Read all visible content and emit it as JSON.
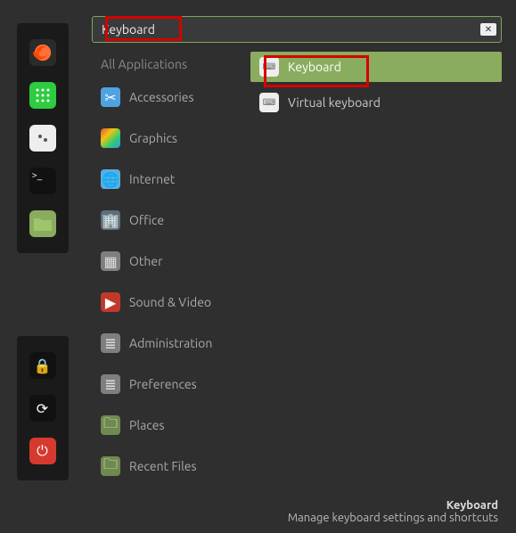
{
  "search": {
    "value": "Keyboard"
  },
  "sidebar": {
    "items": [
      {
        "name": "firefox",
        "glyph": "🦊"
      },
      {
        "name": "apps",
        "glyph": "⋮⋮⋮"
      },
      {
        "name": "software",
        "glyph": "◧"
      },
      {
        "name": "terminal",
        "glyph": ">_"
      },
      {
        "name": "files",
        "glyph": ""
      },
      {
        "name": "lock",
        "glyph": "🔒"
      },
      {
        "name": "refresh",
        "glyph": "⟳"
      },
      {
        "name": "power",
        "glyph": "⏻"
      }
    ]
  },
  "categories": {
    "header": "All Applications",
    "items": [
      {
        "label": "Accessories",
        "icon": "accessories",
        "glyph": "✂"
      },
      {
        "label": "Graphics",
        "icon": "graphics",
        "glyph": ""
      },
      {
        "label": "Internet",
        "icon": "internet",
        "glyph": "🌐"
      },
      {
        "label": "Office",
        "icon": "office",
        "glyph": "🏢"
      },
      {
        "label": "Other",
        "icon": "other",
        "glyph": "▦"
      },
      {
        "label": "Sound & Video",
        "icon": "sound",
        "glyph": "▶"
      },
      {
        "label": "Administration",
        "icon": "admin",
        "glyph": "≣"
      },
      {
        "label": "Preferences",
        "icon": "prefs",
        "glyph": "≣"
      },
      {
        "label": "Places",
        "icon": "places",
        "glyph": "🗀"
      },
      {
        "label": "Recent Files",
        "icon": "recent",
        "glyph": "🗀"
      }
    ]
  },
  "results": [
    {
      "label": "Keyboard",
      "selected": true,
      "glyph": "⌨"
    },
    {
      "label": "Virtual keyboard",
      "selected": false,
      "glyph": "⌨"
    }
  ],
  "footer": {
    "title": "Keyboard",
    "subtitle": "Manage keyboard settings and shortcuts"
  }
}
